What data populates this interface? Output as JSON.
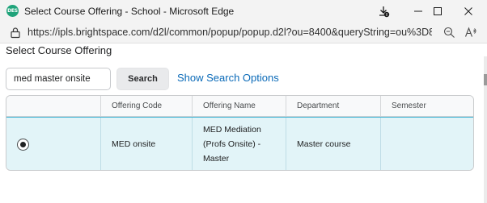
{
  "window": {
    "app_icon_text": "DES",
    "title": "Select Course Offering - School - Microsoft Edge"
  },
  "addressbar": {
    "url": "https://ipls.brightspace.com/d2l/common/popup/popup.d2l?ou=8400&queryString=ou%3D8..."
  },
  "page": {
    "heading": "Select Course Offering",
    "search": {
      "value": "med master onsite",
      "button_label": "Search",
      "show_options_label": "Show Search Options"
    },
    "table": {
      "columns": [
        "",
        "Offering Code",
        "Offering Name",
        "Department",
        "Semester"
      ],
      "rows": [
        {
          "selected": true,
          "offering_code": "MED onsite",
          "offering_name": "MED Mediation (Profs Onsite) - Master",
          "department": "Master course",
          "semester": ""
        }
      ]
    }
  },
  "colors": {
    "link": "#0a6ab8",
    "selected_row": "#e2f4f8",
    "selected_border": "#3fb4d4"
  }
}
